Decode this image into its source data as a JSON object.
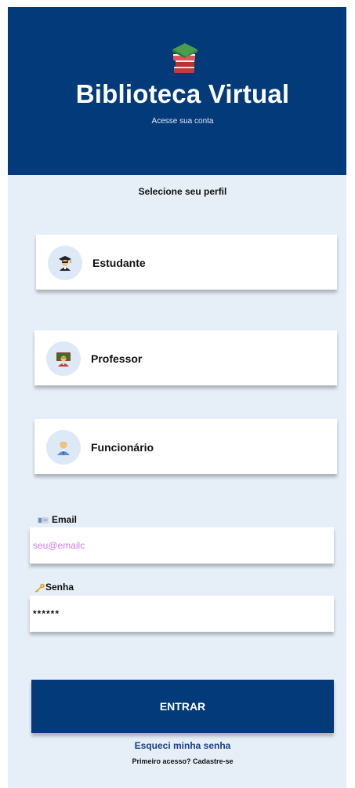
{
  "header": {
    "logo_icon": "books-stack-icon",
    "title": "Biblioteca Virtual",
    "subtitle": "Acesse sua conta",
    "background_color": "#033b7a"
  },
  "profile_section": {
    "title": "Selecione seu perfil",
    "profiles": [
      {
        "label": "Estudante",
        "icon": "student-graduate-icon"
      },
      {
        "label": "Professor",
        "icon": "teacher-icon"
      },
      {
        "label": "Funcionário",
        "icon": "employee-icon"
      }
    ]
  },
  "form": {
    "email": {
      "label": "Email",
      "icon": "email-icon",
      "value": "seu@emailc"
    },
    "password": {
      "label": "Senha",
      "icon": "key-icon",
      "value": "******"
    },
    "submit_label": "ENTRAR"
  },
  "links": {
    "forgot_password": "Esqueci minha senha",
    "signup": "Primeiro acesso? Cadastre-se"
  },
  "colors": {
    "primary": "#033b7a",
    "background": "#e6eef8",
    "email_text": "#d27be6"
  }
}
